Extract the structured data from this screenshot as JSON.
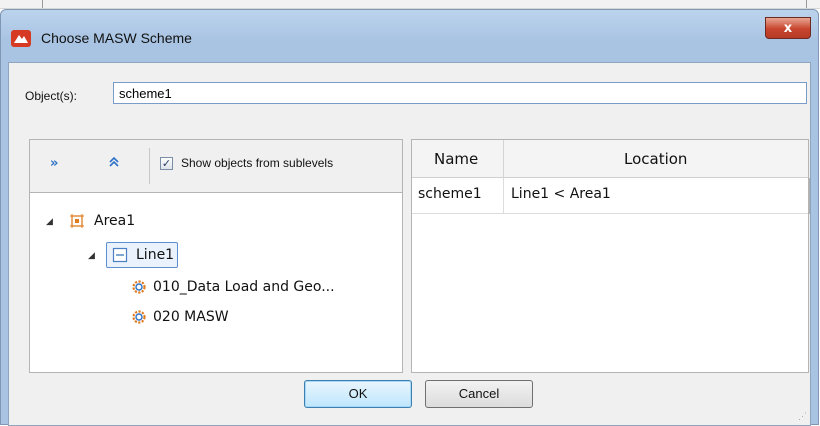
{
  "window": {
    "title": "Choose MASW Scheme",
    "close_label": "x"
  },
  "objects_field": {
    "label": "Object(s):",
    "value": "scheme1"
  },
  "toolbar": {
    "expand_all_icon": "double-chevron-right-icon",
    "collapse_all_icon": "double-chevron-up-icon",
    "show_sublevels_label": "Show objects from sublevels",
    "show_sublevels_checked": true
  },
  "tree": {
    "nodes": [
      {
        "label": "Area1",
        "icon": "area-icon",
        "expanded": true
      },
      {
        "label": "Line1",
        "icon": "line-icon",
        "expanded": true,
        "selected": true
      },
      {
        "label": "010_Data Load and Geo...",
        "icon": "gear-icon"
      },
      {
        "label": "020 MASW",
        "icon": "gear-icon"
      }
    ]
  },
  "results_table": {
    "columns": [
      "Name",
      "Location"
    ],
    "rows": [
      {
        "name": "scheme1",
        "location": "Line1 < Area1"
      }
    ]
  },
  "buttons": {
    "ok": "OK",
    "cancel": "Cancel"
  },
  "colors": {
    "accent": "#2e72c8",
    "icon_orange": "#e07b1f",
    "title_bar": "#a9c4e3"
  }
}
